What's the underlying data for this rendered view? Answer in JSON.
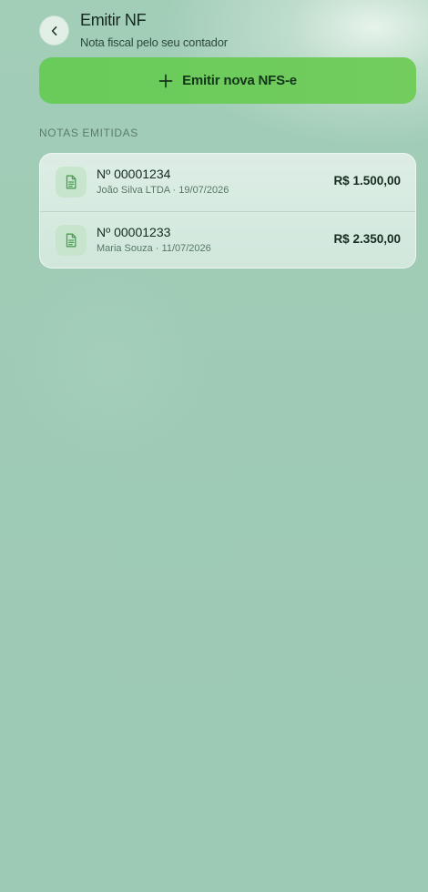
{
  "header": {
    "title": "Emitir NF",
    "subtitle": "Nota fiscal pelo seu contador"
  },
  "actions": {
    "issue_button_label": "Emitir nova NFS-e"
  },
  "section": {
    "label": "NOTAS EMITIDAS"
  },
  "notes": [
    {
      "number": "Nº 00001234",
      "meta": "João Silva LTDA · 19/07/2026",
      "amount": "R$ 1.500,00"
    },
    {
      "number": "Nº 00001233",
      "meta": "Maria Souza · 11/07/2026",
      "amount": "R$ 2.350,00"
    }
  ],
  "colors": {
    "accent": "#6ccb5b",
    "background": "#a0ccb6",
    "icon_green": "#4f9a56"
  },
  "icons": {
    "back": "chevron-left-icon",
    "add": "plus-icon",
    "document": "document-icon"
  }
}
